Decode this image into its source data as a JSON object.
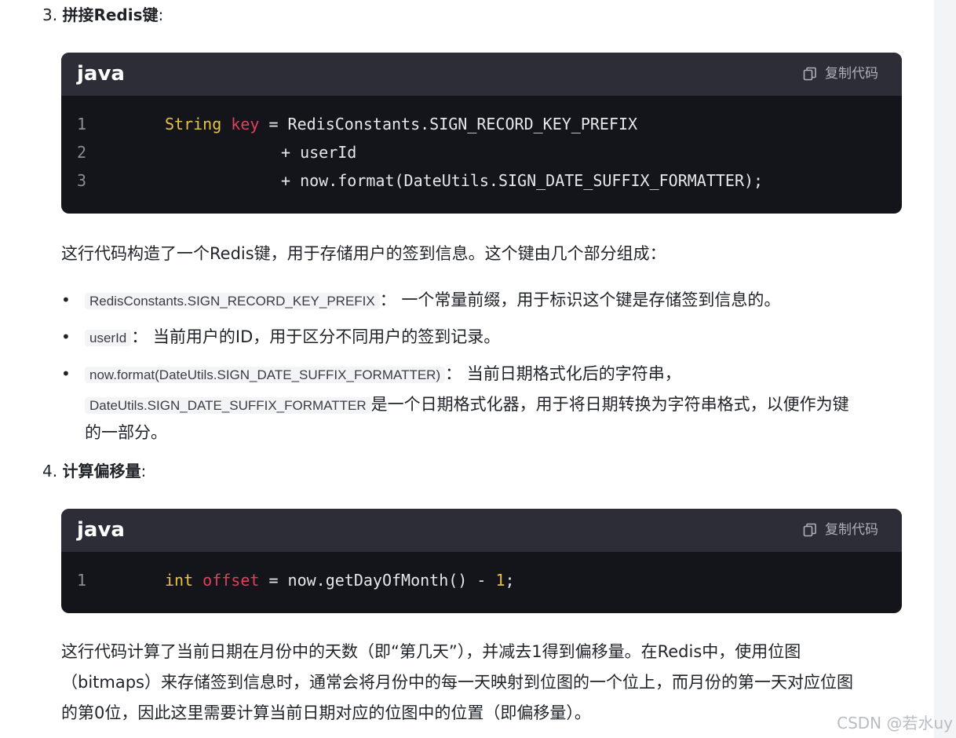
{
  "step3": {
    "num": "3.",
    "title": "拼接Redis键",
    "colon": ":"
  },
  "code1": {
    "lang": "java",
    "copy_label": "复制代码",
    "lines": [
      {
        "n": "1",
        "type": "String",
        "var": "key",
        "rest": " = RedisConstants.SIGN_RECORD_KEY_PREFIX"
      },
      {
        "n": "2",
        "text": "+ userId"
      },
      {
        "n": "3",
        "text": "+ now.format(DateUtils.SIGN_DATE_SUFFIX_FORMATTER);"
      }
    ]
  },
  "para1": "这行代码构造了一个Redis键，用于存储用户的签到信息。这个键由几个部分组成：",
  "bullets": [
    {
      "code": "RedisConstants.SIGN_RECORD_KEY_PREFIX",
      "text": "： 一个常量前缀，用于标识这个键是存储签到信息的。"
    },
    {
      "code": "userId",
      "text": "： 当前用户的ID，用于区分不同用户的签到记录。"
    },
    {
      "code": "now.format(DateUtils.SIGN_DATE_SUFFIX_FORMATTER)",
      "text": "： 当前日期格式化后的字符串，",
      "code2": "DateUtils.SIGN_DATE_SUFFIX_FORMATTER",
      "text2": "是一个日期格式化器，用于将日期转换为字符串格式，以便作为键",
      "text3": "的一部分。"
    }
  ],
  "step4": {
    "num": "4.",
    "title": "计算偏移量",
    "colon": ":"
  },
  "code2": {
    "lang": "java",
    "copy_label": "复制代码",
    "lines": [
      {
        "n": "1",
        "type": "int",
        "var": "offset",
        "mid": " = now.getDayOfMonth() - ",
        "num": "1",
        "end": ";"
      }
    ]
  },
  "para2": {
    "line1": "这行代码计算了当前日期在月份中的天数（即“第几天”），并减去1得到偏移量。在Redis中，使用位图",
    "line2": "（bitmaps）来存储签到信息时，通常会将月份中的每一天映射到位图的一个位上，而月份的第一天对应位图",
    "line3": "的第0位，因此这里需要计算当前日期对应的位图中的位置（即偏移量）。"
  },
  "watermark": "CSDN @若水uy",
  "colors": {
    "code_bg": "#14141b",
    "code_header": "#2d2d37",
    "type": "#e6c14a",
    "var": "#e0405a"
  },
  "icons": {
    "copy": "copy-icon"
  }
}
